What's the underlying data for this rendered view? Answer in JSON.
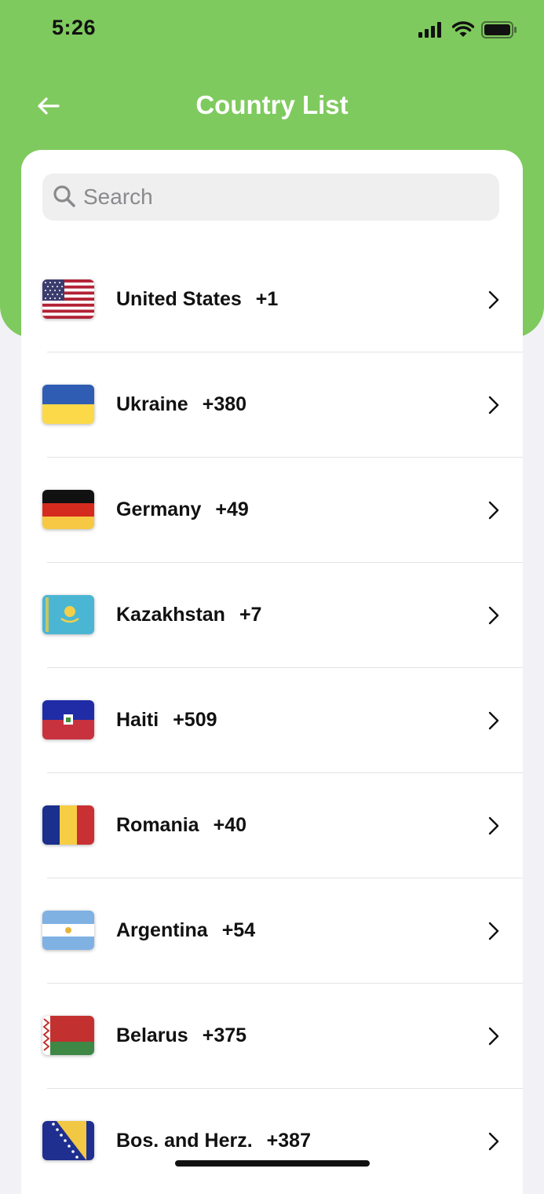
{
  "status_bar": {
    "time": "5:26"
  },
  "header": {
    "title": "Country List",
    "back_icon": "arrow-left-icon"
  },
  "search": {
    "placeholder": "Search",
    "value": ""
  },
  "countries": [
    {
      "name": "United States",
      "code": "+1",
      "flag": "flag-us"
    },
    {
      "name": "Ukraine",
      "code": "+380",
      "flag": "flag-ua"
    },
    {
      "name": "Germany",
      "code": "+49",
      "flag": "flag-de"
    },
    {
      "name": "Kazakhstan",
      "code": "+7",
      "flag": "flag-kz"
    },
    {
      "name": "Haiti",
      "code": "+509",
      "flag": "flag-ht"
    },
    {
      "name": "Romania",
      "code": "+40",
      "flag": "flag-ro"
    },
    {
      "name": "Argentina",
      "code": "+54",
      "flag": "flag-ar"
    },
    {
      "name": "Belarus",
      "code": "+375",
      "flag": "flag-by"
    },
    {
      "name": "Bos. and Herz.",
      "code": "+387",
      "flag": "flag-ba"
    }
  ],
  "colors": {
    "header_green": "#7FCA5E",
    "background": "#F1F1F6",
    "card": "#FFFFFF",
    "search_bg": "#EFEFEF",
    "text": "#111111"
  }
}
